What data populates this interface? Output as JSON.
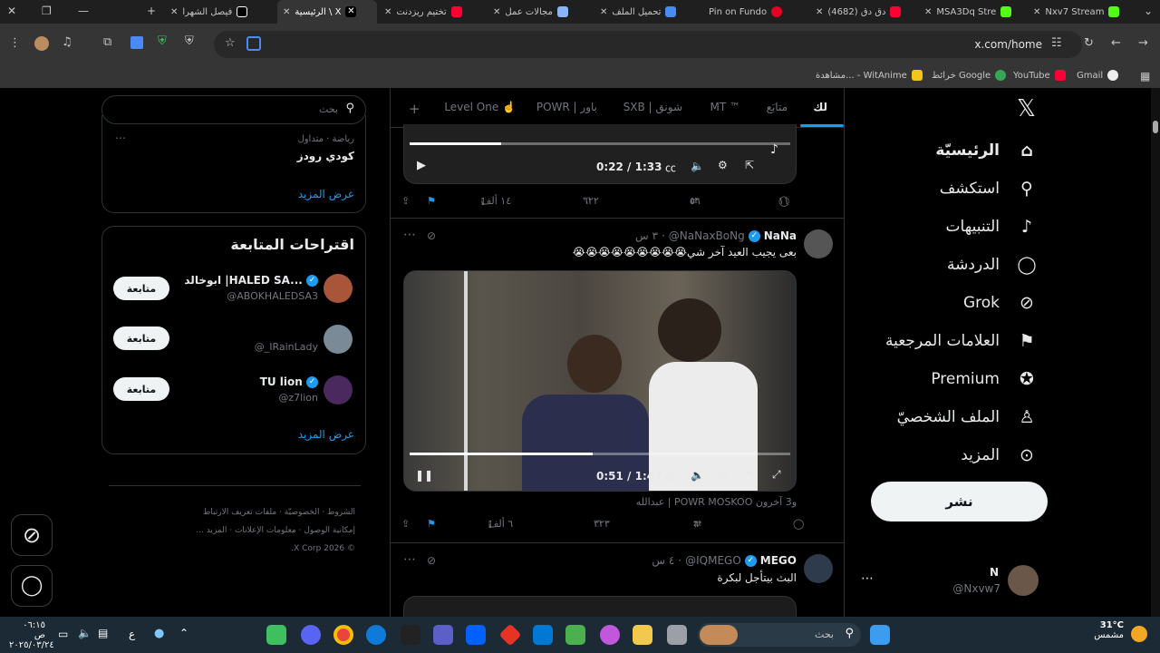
{
  "browser": {
    "tabs": [
      {
        "label": "Nxv7 Stream",
        "color": "#53fc18"
      },
      {
        "label": "MSA3Dq Stre",
        "color": "#53fc18"
      },
      {
        "label": "(4682) دق دق",
        "color": "#ff0033"
      },
      {
        "label": "Pin on Fundo",
        "color": "#e60023"
      },
      {
        "label": "تحميل الملف",
        "color": "#4a8af4"
      },
      {
        "label": "مجالات عمل",
        "color": "#8ab4f8"
      },
      {
        "label": "تختيم ريزدنت",
        "color": "#ff0033"
      },
      {
        "label": "الرئيسية \\ X",
        "color": "#ffffff"
      },
      {
        "label": "فيصل الشهرا",
        "color": "#000000"
      }
    ],
    "url": "x.com/home",
    "bookmarks": [
      "Gmail",
      "YouTube",
      "خرائط Google",
      "مشاهدة... - WitAnime"
    ]
  },
  "nav": {
    "items": [
      {
        "label": "الرئيسيّة",
        "icon": "home-icon",
        "glyph": "⌂"
      },
      {
        "label": "استكشف",
        "icon": "search-icon",
        "glyph": "⚲"
      },
      {
        "label": "التنبيهات",
        "icon": "bell-icon",
        "glyph": "🔔"
      },
      {
        "label": "الدردشة",
        "icon": "chat-icon",
        "glyph": "◯"
      },
      {
        "label": "Grok",
        "icon": "grok-icon",
        "glyph": "⊘"
      },
      {
        "label": "العلامات المرجعية",
        "icon": "bookmark-icon",
        "glyph": "🔖"
      },
      {
        "label": "Premium",
        "icon": "verified-icon",
        "glyph": "✪"
      },
      {
        "label": "الملف الشخصيّ",
        "icon": "person-icon",
        "glyph": "👤"
      },
      {
        "label": "المزيد",
        "icon": "more-icon",
        "glyph": "⋯"
      }
    ],
    "post_button": "نشر",
    "account": {
      "name": "N",
      "handle": "@Nxvw7"
    }
  },
  "feed": {
    "tabs": [
      "لك",
      "متابَع",
      "MT ™",
      "SXB | شونق",
      "POWR | باور",
      "Level One ☝️",
      "+"
    ],
    "tweet1": {
      "video": {
        "current": "0:22",
        "duration": "1:33",
        "progress": 0.24
      },
      "actions": {
        "replies": "١١",
        "retweets": "٥٦",
        "likes": "٦٢٢",
        "views": "١٤ ألف"
      }
    },
    "tweet2": {
      "name": "NaNa",
      "handle": "@NaNaxBoNg",
      "time": "٣ س",
      "text": "بعى يجيب العيد آخر شي😭😭😭😭😭😭😭😭😭",
      "video": {
        "current": "0:51",
        "duration": "1:47",
        "progress": 0.48
      },
      "tagged": "عبدالله | POWR MOSKOO و3 آخرون",
      "actions": {
        "replies": "",
        "retweets": "٦",
        "likes": "٣٢٣",
        "views": "٦ ألف"
      }
    },
    "tweet3": {
      "name": "MEGO",
      "handle": "@IQMEGO",
      "time": "٤ س",
      "text": "البث بيتأجل لبكرة"
    }
  },
  "sidebar": {
    "search_placeholder": "بحث",
    "trend": {
      "category": "رياضة · متداول",
      "title": "كودي رودز"
    },
    "show_more": "عرض المزيد",
    "who_to_follow_title": "اقتراحات المتابعة",
    "suggestions": [
      {
        "name": "ابوخالد |HALED SA...",
        "handle": "@ABOKHALEDSA3",
        "follow": "متابعة"
      },
      {
        "name": "",
        "handle": "@_IRainLady",
        "follow": "متابعة"
      },
      {
        "name": "TU lion",
        "handle": "@z7lion",
        "follow": "متابعة"
      }
    ],
    "footer": {
      "links": [
        "الشروط",
        "الخصوصيّة",
        "ملفات تعريف الارتباط",
        "إمكانية الوصول",
        "معلومات الإعلانات",
        "المزيد ..."
      ],
      "copyright": "© 2026 X Corp."
    }
  },
  "taskbar": {
    "weather_temp": "31°C",
    "weather_desc": "مشمس",
    "search": "بحث",
    "time": "٠٦:١٥ ص",
    "date": "٢٠٢٥/٠٣/٢٤",
    "lang": "ع"
  }
}
